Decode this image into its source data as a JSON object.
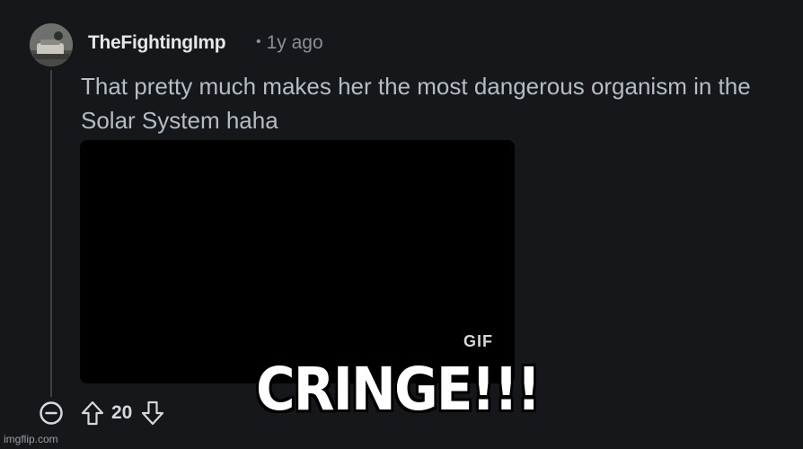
{
  "comment": {
    "author": "TheFightingImp",
    "separator": "•",
    "age": "1y ago",
    "body": "That pretty much makes her the most dangerous organism in the Solar System haha",
    "media_badge": "GIF",
    "votes": "20"
  },
  "meme": {
    "caption": "CRINGE!!!",
    "watermark": "imgflip.com"
  },
  "colors": {
    "background": "#15171b",
    "username": "#e5e7ea",
    "body_text": "#b4bcc5",
    "meta_text": "#8a9097"
  },
  "icons": {
    "collapse": "minus-circle-icon",
    "upvote": "arrow-up-icon",
    "downvote": "arrow-down-icon"
  }
}
